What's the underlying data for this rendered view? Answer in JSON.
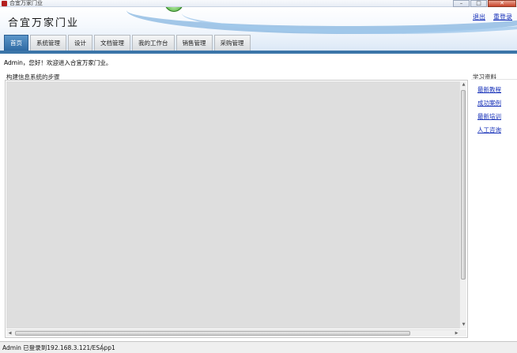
{
  "window": {
    "title": "合宜万家门业",
    "minimize": "–",
    "maximize": "□",
    "close": "✕"
  },
  "header": {
    "company_name": "合宜万家门业",
    "links": [
      "退出",
      "重登录"
    ]
  },
  "tabs": [
    {
      "label": "首页",
      "active": true
    },
    {
      "label": "系统管理",
      "active": false
    },
    {
      "label": "设计",
      "active": false
    },
    {
      "label": "文档管理",
      "active": false
    },
    {
      "label": "我的工作台",
      "active": false
    },
    {
      "label": "销售管理",
      "active": false
    },
    {
      "label": "采购管理",
      "active": false
    }
  ],
  "welcome": "Admin，您好！欢迎进入合宜万家门业。",
  "main_panel": {
    "title": "构建信息系统的步骤"
  },
  "sidebar": {
    "title": "学习资料",
    "links": [
      "最新教程",
      "成功案例",
      "最新培训",
      "人工咨询"
    ]
  },
  "statusbar": {
    "text": "Admin 已登录到192.168.3.121/ESApp1"
  },
  "colors": {
    "tab_active": "#3b75a8",
    "link": "#1630b8",
    "content_bg": "#dedede"
  }
}
